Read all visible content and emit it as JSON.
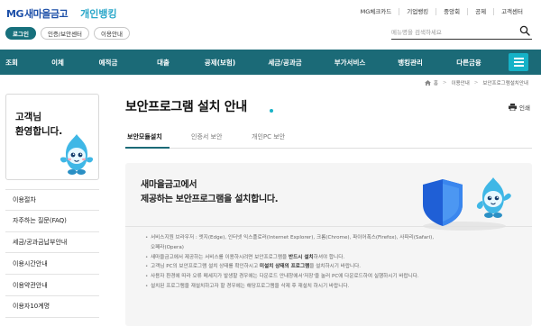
{
  "header": {
    "logo_mg": "MG",
    "logo_name": "새마을금고",
    "logo_bank": "개인뱅킹",
    "util_links": [
      "MG체크카드",
      "기업뱅킹",
      "중앙회",
      "공제",
      "고객센터"
    ],
    "pills": [
      "로그인",
      "인증/보안센터",
      "이용안내"
    ],
    "search_placeholder": "메뉴명을 검색하세요"
  },
  "nav": {
    "items": [
      "조회",
      "이체",
      "예적금",
      "대출",
      "공제(보험)",
      "세금/공과금",
      "부가서비스",
      "뱅킹관리",
      "다른금융"
    ]
  },
  "breadcrumb": [
    "홈",
    "이용안내",
    "보안프로그램설치안내"
  ],
  "sidebar": {
    "greeting_line1": "고객님",
    "greeting_line2": "환영합니다.",
    "menu": [
      "이용절차",
      "자주하는 질문(FAQ)",
      "세금/공과금납부안내",
      "이용시간안내",
      "이용약관안내",
      "이용자10계명"
    ]
  },
  "main": {
    "title": "보안프로그램 설치 안내",
    "print_label": "인쇄",
    "tabs": [
      "보안모듈설치",
      "인증서 보안",
      "개인PC 보안"
    ],
    "lead_line1": "새마을금고에서",
    "lead_line2": "제공하는 보안프로그램을 설치합니다.",
    "notes": [
      {
        "text": "서비스지원 브라우저 : 엣지(Edge), 인터넷 익스플로러(Internet Explorer), 크롬(Chrome), 파이어폭스(Firefox), 사파리(Safari),"
      },
      {
        "text": "오페라(Opera)"
      },
      {
        "pre": "새마을금고에서 제공하는 서비스를 이용하시려면 보안프로그램을 ",
        "strong": "반드시 설치",
        "post": "하셔야 합니다."
      },
      {
        "pre": "고객님 PC의 보안프로그램 설치 상태를 확인하시고 ",
        "strong": "미설치 상태의 프로그램",
        "post": "을 설치하시기 바랍니다."
      },
      {
        "text": "사용자 환경에 따라 오류 메세지가 발생할 경우에는 다운로드 안내창에서'저장'을 눌러 PC에 다운로드하여 실행하시기 바랍니다."
      },
      {
        "text": "설치된 프로그램을 재설치하고자 할 경우에는 해당프로그램을 삭제 후 재설치 하시기 바랍니다."
      }
    ]
  },
  "colors": {
    "brand_teal": "#1b6a77",
    "accent_cyan": "#15b2c7",
    "logo_blue": "#1c4fa8"
  }
}
